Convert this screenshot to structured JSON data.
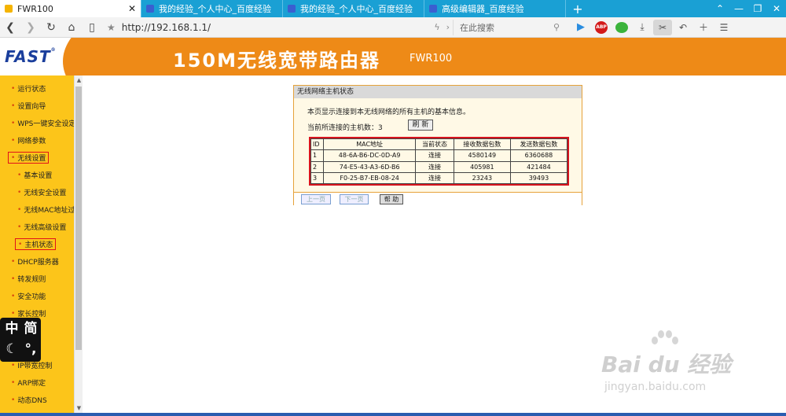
{
  "browser": {
    "tabs": [
      {
        "title": "FWR100",
        "active": true
      },
      {
        "title": "我的经验_个人中心_百度经验",
        "active": false
      },
      {
        "title": "我的经验_个人中心_百度经验",
        "active": false
      },
      {
        "title": "高级编辑器_百度经验",
        "active": false
      }
    ],
    "new_tab": "+",
    "url": "http://192.168.1.1/",
    "search_placeholder": "在此搜索",
    "abp_label": "ABP"
  },
  "router": {
    "logo": "FAST",
    "logo_mark": "®",
    "title": "150M无线宽带路由器",
    "model": "FWR100"
  },
  "menu": {
    "items": [
      {
        "label": "运行状态"
      },
      {
        "label": "设置向导"
      },
      {
        "label": "WPS一键安全设定"
      },
      {
        "label": "网络参数"
      },
      {
        "label": "无线设置"
      },
      {
        "label": "基本设置"
      },
      {
        "label": "无线安全设置"
      },
      {
        "label": "无线MAC地址过滤"
      },
      {
        "label": "无线高级设置"
      },
      {
        "label": "主机状态"
      },
      {
        "label": "DHCP服务器"
      },
      {
        "label": "转发规则"
      },
      {
        "label": "安全功能"
      },
      {
        "label": "家长控制"
      },
      {
        "label": "IP带宽控制"
      },
      {
        "label": "ARP绑定"
      },
      {
        "label": "动态DNS"
      }
    ]
  },
  "ime": {
    "c1": "中",
    "c2": "简",
    "c3": "☾",
    "c4": "°,"
  },
  "panel": {
    "title": "无线网络主机状态",
    "description": "本页显示连接到本无线网络的所有主机的基本信息。",
    "count_label": "当前所连接的主机数：3",
    "refresh_label": "刷 新",
    "headers": [
      "ID",
      "MAC地址",
      "当前状态",
      "接收数据包数",
      "发送数据包数"
    ],
    "rows": [
      [
        "1",
        "48-6A-B6-DC-0D-A9",
        "连接",
        "4580149",
        "6360688"
      ],
      [
        "2",
        "74-E5-43-A3-6D-B6",
        "连接",
        "405981",
        "421484"
      ],
      [
        "3",
        "F0-25-B7-EB-08-24",
        "连接",
        "23243",
        "39493"
      ]
    ],
    "prev_label": "上一页",
    "next_label": "下一页",
    "help_label": "帮 助"
  },
  "watermark": {
    "brand": "Bai du 经验",
    "url": "jingyan.baidu.com"
  }
}
